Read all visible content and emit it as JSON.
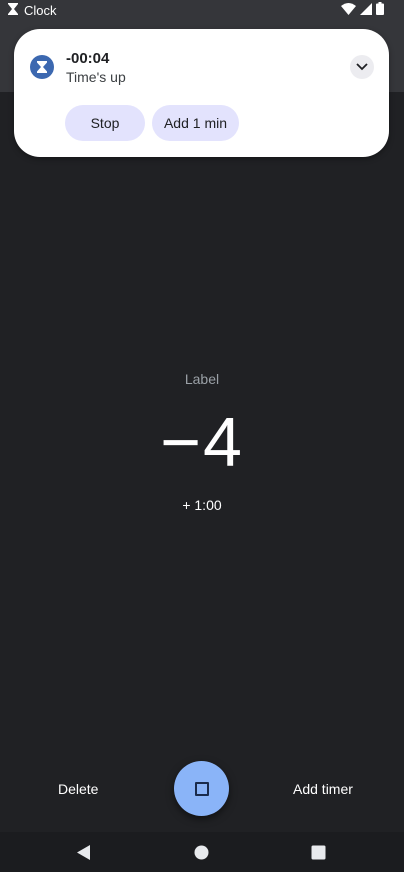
{
  "status_bar": {
    "app_name": "Clock"
  },
  "notification": {
    "title": "-00:04",
    "text": "Time's up",
    "actions": {
      "stop": "Stop",
      "add_minute": "Add 1 min"
    }
  },
  "timer": {
    "label": "Label",
    "time": "−4",
    "add_minute": "+ 1:00"
  },
  "bottom_bar": {
    "delete": "Delete",
    "add_timer": "Add timer"
  },
  "colors": {
    "background": "#202124",
    "accent": "#8ab4f8",
    "chip": "#e3e3fd"
  }
}
